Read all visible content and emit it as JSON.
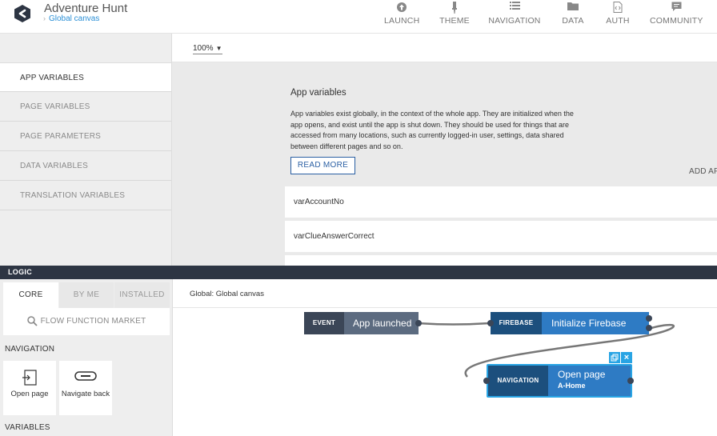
{
  "header": {
    "app_name": "Adventure Hunt",
    "canvas_name": "Global canvas",
    "nav": [
      {
        "label": "LAUNCH",
        "icon": "launch-icon"
      },
      {
        "label": "THEME",
        "icon": "theme-brush-icon"
      },
      {
        "label": "NAVIGATION",
        "icon": "navigation-list-icon"
      },
      {
        "label": "DATA",
        "icon": "data-folder-icon"
      },
      {
        "label": "AUTH",
        "icon": "auth-icon"
      },
      {
        "label": "COMMUNITY",
        "icon": "community-chat-icon"
      }
    ]
  },
  "zoom": {
    "value": "100%"
  },
  "variables_panel": {
    "items": [
      {
        "label": "APP VARIABLES",
        "active": true
      },
      {
        "label": "PAGE VARIABLES",
        "active": false
      },
      {
        "label": "PAGE PARAMETERS",
        "active": false
      },
      {
        "label": "DATA VARIABLES",
        "active": false
      },
      {
        "label": "TRANSLATION VARIABLES",
        "active": false
      }
    ]
  },
  "main": {
    "title": "App variables",
    "description": "App variables exist globally, in the context of the whole app. They are initialized when the app opens, and exist until the app is shut down. They should be used for things that are accessed from many locations, such as currently logged-in user, settings, data shared between different pages and so on.",
    "read_more": "READ MORE",
    "add_label": "ADD AF",
    "variables": [
      "varAccountNo",
      "varClueAnswerCorrect"
    ]
  },
  "logic": {
    "bar_title": "LOGIC",
    "tabs": [
      {
        "label": "CORE",
        "active": true
      },
      {
        "label": "BY ME",
        "active": false
      },
      {
        "label": "INSTALLED",
        "active": false
      }
    ],
    "market_label": "FLOW FUNCTION MARKET",
    "section_navigation": "NAVIGATION",
    "section_variables": "VARIABLES",
    "blocks": [
      {
        "label": "Open page",
        "icon": "open-page-icon"
      },
      {
        "label": "Navigate back",
        "icon": "navigate-back-icon"
      }
    ],
    "canvas_title": "Global: Global canvas",
    "nodes": {
      "event": {
        "tag": "EVENT",
        "label": "App launched"
      },
      "firebase": {
        "tag": "FIREBASE",
        "label": "Initialize Firebase"
      },
      "navigation": {
        "tag": "NAVIGATION",
        "label": "Open page",
        "sub": "A-Home"
      }
    }
  },
  "colors": {
    "accent": "#2a8fd6",
    "logic_bar": "#2d3543",
    "event_tag": "#3b4657",
    "event_body": "#5c6b80",
    "firebase_tag": "#1c4f7d",
    "firebase_body": "#2e7bc4",
    "selection": "#28a4e4"
  }
}
